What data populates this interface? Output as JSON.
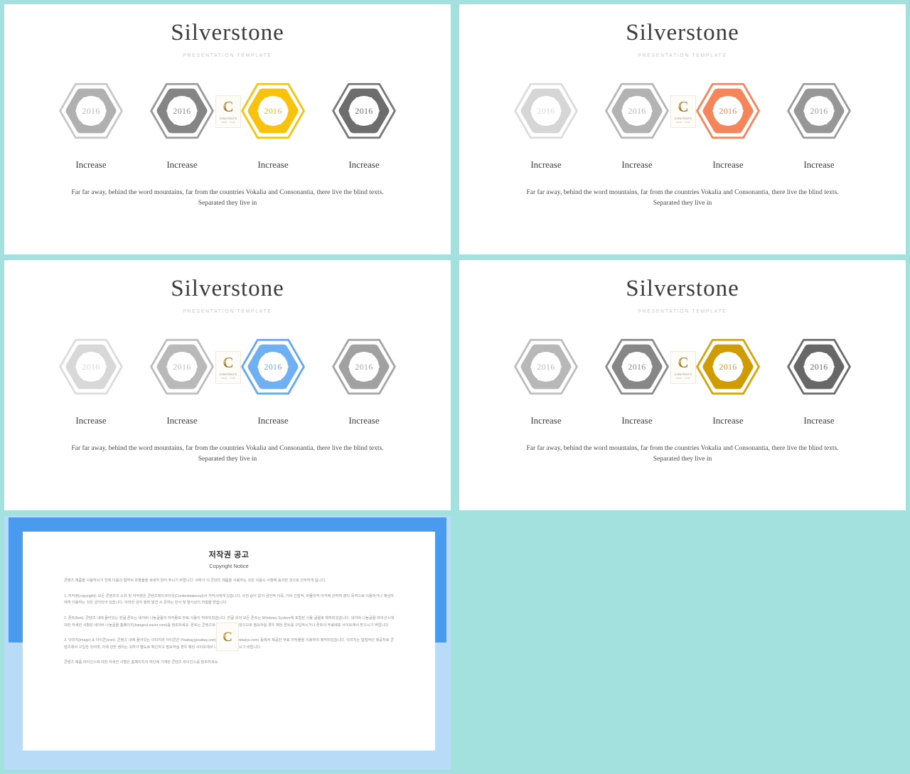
{
  "background_color": "#a3e1df",
  "slides": [
    {
      "id": "slide-1",
      "title": "Silverstone",
      "subtitle": "PRESENTATION TEMPLATE",
      "body": "Far far away, behind the word mountains, far from the countries Vokalia and Consonantia, there live the blind texts. Separated they live in",
      "hexes": [
        {
          "year": "2016",
          "label": "Increase",
          "outline": "#c7c7c7",
          "fill": "#b0b0b0",
          "year_color": "#b8b8b8"
        },
        {
          "year": "2016",
          "label": "Increase",
          "outline": "#9a9a9a",
          "fill": "#858585",
          "year_color": "#8c8c8c"
        },
        {
          "year": "2016",
          "label": "Increase",
          "outline": "#f5c20f",
          "fill": "#f8c20d",
          "year_color": "#e8b70b"
        },
        {
          "year": "2016",
          "label": "Increase",
          "outline": "#777777",
          "fill": "#6d6d6d",
          "year_color": "#6e6e6e"
        }
      ]
    },
    {
      "id": "slide-2",
      "title": "Silverstone",
      "subtitle": "PRESENTATION TEMPLATE",
      "body": "Far far away, behind the word mountains, far from the countries Vokalia and Consonantia, there live the blind texts. Separated they live in",
      "hexes": [
        {
          "year": "2016",
          "label": "Increase",
          "outline": "#dcdcdc",
          "fill": "#d6d6d6",
          "year_color": "#d9d9d9"
        },
        {
          "year": "2016",
          "label": "Increase",
          "outline": "#b7b7b7",
          "fill": "#b3b3b3",
          "year_color": "#b5b5b5"
        },
        {
          "year": "2016",
          "label": "Increase",
          "outline": "#f4845a",
          "fill": "#f5855b",
          "year_color": "#ef8156"
        },
        {
          "year": "2016",
          "label": "Increase",
          "outline": "#9b9b9b",
          "fill": "#979797",
          "year_color": "#9a9a9a"
        }
      ]
    },
    {
      "id": "slide-3",
      "title": "Silverstone",
      "subtitle": "PRESENTATION TEMPLATE",
      "body": "Far far away, behind the word mountains, far from the countries Vokalia and Consonantia, there live the blind texts. Separated they live in",
      "hexes": [
        {
          "year": "2016",
          "label": "Increase",
          "outline": "#dcdcdc",
          "fill": "#d8d8d8",
          "year_color": "#dadada"
        },
        {
          "year": "2016",
          "label": "Increase",
          "outline": "#bdbdbd",
          "fill": "#b9b9b9",
          "year_color": "#bcbcbc"
        },
        {
          "year": "2016",
          "label": "Increase",
          "outline": "#62a8ee",
          "fill": "#6fb0f2",
          "year_color": "#5ea4ec"
        },
        {
          "year": "2016",
          "label": "Increase",
          "outline": "#a5a5a5",
          "fill": "#a1a1a1",
          "year_color": "#a3a3a3"
        }
      ]
    },
    {
      "id": "slide-4",
      "title": "Silverstone",
      "subtitle": "PRESENTATION TEMPLATE",
      "body": "Far far away, behind the word mountains, far from the countries Vokalia and Consonantia, there live the blind texts. Separated they live in",
      "hexes": [
        {
          "year": "2016",
          "label": "Increase",
          "outline": "#bdbdbd",
          "fill": "#b8b8b8",
          "year_color": "#bababa"
        },
        {
          "year": "2016",
          "label": "Increase",
          "outline": "#8b8b8b",
          "fill": "#878787",
          "year_color": "#8a8a8a"
        },
        {
          "year": "2016",
          "label": "Increase",
          "outline": "#d5a40c",
          "fill": "#cf9c06",
          "year_color": "#c99a0b"
        },
        {
          "year": "2016",
          "label": "Increase",
          "outline": "#6b6b6b",
          "fill": "#676767",
          "year_color": "#6a6a6a"
        }
      ]
    }
  ],
  "watermark": {
    "letter": "C",
    "line1": "CONTENTS",
    "line2": "REAL . COM"
  },
  "copyright_panel": {
    "frame_color": "#4a9bf0",
    "title": "저작권 공고",
    "subtitle": "Copyright Notice",
    "paragraphs": [
      "콘텐츠 제품을 사용하시기 전에 다음의 협약서 조항들을 세세히 읽어 주시기 바랍니다. 귀하가 이 콘텐츠 제품을 사용하는 것은 사용시 사항에 동의한 것으로 간주하게 됩니다.",
      "1. 저작권(copyright): 모든 콘텐츠의 소유 및 저작권은 콘텐츠테이크아웃(Contentstakeout)사 저작사에게 있습니다. 사전 승낙 없이 금전적 이득, 기타 간접적, 비물리적 이익에 관하여 영리 목적으로 이용하거나 제삼자에게 이용하는 것은 금지되어 있습니다. 이러한 금지 행위 발견 시 준하는 민사 및 형사상의 처벌을 받습니다.",
      "2. 폰트(font): 콘텐츠 내에 들어있는 한글 폰트는 네이버 나눔글꼴의 저작물로 무료 사용이 허락되었습니다. 한글 외의 모든 폰트는 Windows System에 포함된 사용 글꼴로 제작되었습니다. 네이버 나눔글꼴 라이선스에 대한 자세한 사항은 네이버 나눔글꼴 홈페이지(hangeul.naver.com)를 참조하세요. 폰트는 콘텐츠와 함께 제공되지 않으므로 필요하실 경우 해당 폰트를 구입하시거나 폰트의 무료배포 사이트에서 받으시기 바랍니다.",
      "3. 이미지(image) & 아이콘(icon): 콘텐츠 내에 들어있는 이미지와 아이콘은 Pixabay(pixabay.com)와 Webalys(webalys.com) 등에서 제공한 무료 저작물을 이용하여 제작되었습니다. 이미지는 합법적인 제공처로 콘텐츠에서 구입한 것이며, 이에 관한 권리는 귀하가 별도로 확인하고 필요하실 경우 해당 사이트에서 내려받아 사용하시기 바랍니다.",
      "콘텐츠 제품 라이선스에 대한 자세한 사항은 홈페이지의 하단에 기재된 콘텐츠 라이선스를 참조하세요."
    ]
  }
}
